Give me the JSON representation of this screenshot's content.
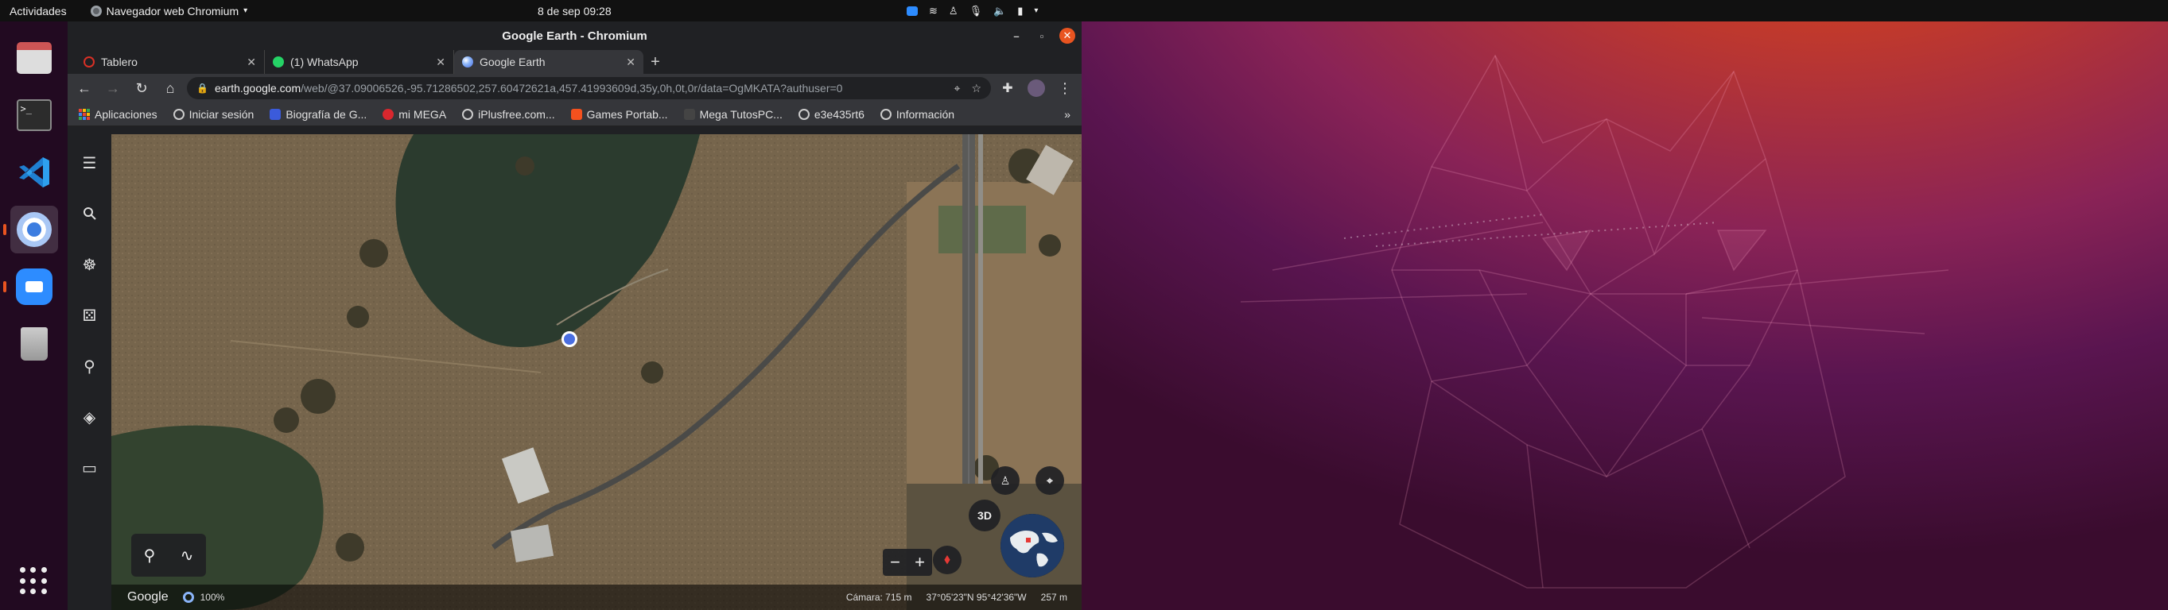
{
  "topbar": {
    "activities": "Actividades",
    "app_name": "Navegador web Chromium",
    "clock": "8 de sep  09:28"
  },
  "window": {
    "title": "Google Earth - Chromium"
  },
  "tabs": [
    {
      "title": "Tablero",
      "icon_color": "#d93025"
    },
    {
      "title": "(1) WhatsApp",
      "icon_color": "#25d366"
    },
    {
      "title": "Google Earth",
      "icon_color": "#8ab4f8"
    }
  ],
  "omnibox": {
    "host": "earth.google.com",
    "path": "/web/@37.09006526,-95.71286502,257.60472621a,457.41993609d,35y,0h,0t,0r/data=OgMKATA?authuser=0"
  },
  "bookmarks": [
    {
      "label": "Aplicaciones",
      "color": "#ea4335"
    },
    {
      "label": "Iniciar sesión",
      "color": "#cccccc"
    },
    {
      "label": "Biografía de G...",
      "color": "#3b5bdb"
    },
    {
      "label": "mi MEGA",
      "color": "#d9272e"
    },
    {
      "label": "iPlusfree.com...",
      "color": "#cccccc"
    },
    {
      "label": "Games Portab...",
      "color": "#f4511e"
    },
    {
      "label": "Mega TutosPC...",
      "color": "#444444"
    },
    {
      "label": "e3e435rt6",
      "color": "#cccccc"
    },
    {
      "label": "Información",
      "color": "#cccccc"
    }
  ],
  "map": {
    "zoom_label": "100%",
    "google_logo": "Google",
    "btn_3d": "3D",
    "camera": "Cámara: 715 m",
    "coords": "37°05'23\"N 95°42'36\"W",
    "elevation": "257 m"
  },
  "colors": {
    "accent": "#e95420",
    "chrome_dark": "#202124",
    "chrome_toolbar": "#35363a"
  }
}
